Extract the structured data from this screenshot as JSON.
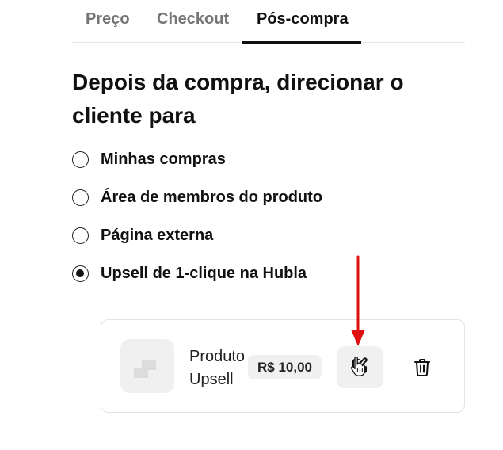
{
  "tabs": [
    {
      "label": "Preço",
      "active": false
    },
    {
      "label": "Checkout",
      "active": false
    },
    {
      "label": "Pós-compra",
      "active": true
    }
  ],
  "heading": "Depois da compra, direcionar o cliente para",
  "redirect_options": [
    {
      "label": "Minhas compras",
      "checked": false
    },
    {
      "label": "Área de membros do produto",
      "checked": false
    },
    {
      "label": "Página externa",
      "checked": false
    },
    {
      "label": "Upsell de 1-clique na Hubla",
      "checked": true
    }
  ],
  "upsell_card": {
    "product_name": "Produto Upsell",
    "price": "R$ 10,00",
    "thumbnail_icon": "product-placeholder-icon",
    "edit_icon": "edit-pencil-icon",
    "delete_icon": "trash-icon"
  },
  "annotation": {
    "arrow_color": "#e01010",
    "cursor": "hand-pointer-icon"
  },
  "colors": {
    "text_primary": "#111111",
    "text_muted": "#757575",
    "surface_gray": "#f0f0f0",
    "border": "#e4e4e4"
  }
}
